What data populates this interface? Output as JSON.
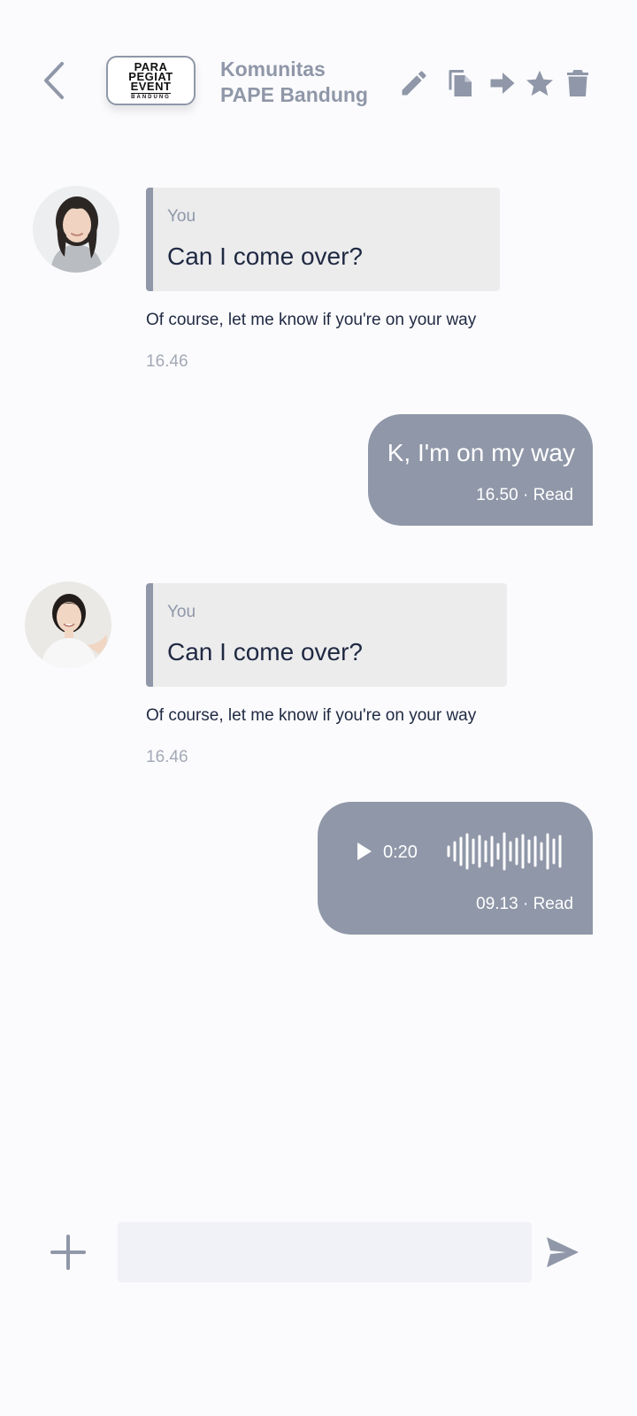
{
  "header": {
    "logo_lines": [
      "PARA",
      "PEGIAT",
      "EVENT",
      "BANDUNG"
    ],
    "title_line1": "Komunitas",
    "title_line2": "PAPE Bandung",
    "icons": [
      "chevron-left-icon",
      "pencil-icon",
      "copy-icon",
      "forward-arrow-icon",
      "star-icon",
      "trash-icon"
    ]
  },
  "messages": [
    {
      "type": "incoming-reply",
      "quote_author": "You",
      "quote_text": "Can I come over?",
      "text": "Of course, let me know if you're on your way",
      "time": "16.46"
    },
    {
      "type": "outgoing-text",
      "text": "K, I'm on my way",
      "meta": "16.50 · Read"
    },
    {
      "type": "incoming-reply",
      "quote_author": "You",
      "quote_text": "Can I come over?",
      "text": "Of course, let me know if you're on your way",
      "time": "16.46"
    },
    {
      "type": "outgoing-voice",
      "duration": "0:20",
      "meta": "09.13 · Read"
    }
  ],
  "composer": {
    "placeholder": "",
    "icons": [
      "plus-icon",
      "send-icon"
    ]
  },
  "colors": {
    "accent": "#8f97a8",
    "text_dark": "#1f2942",
    "quote_bg": "#ececed",
    "input_bg": "#f1f2f7",
    "background": "#fbfbfd"
  }
}
